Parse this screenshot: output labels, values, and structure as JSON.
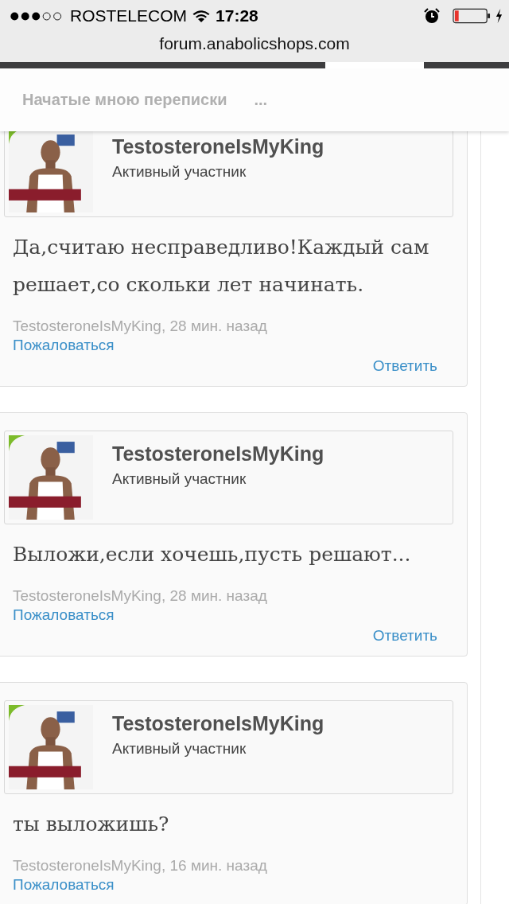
{
  "status_bar": {
    "carrier": "ROSTELECOM",
    "time": "17:28"
  },
  "address_bar": {
    "url": "forum.anabolicshops.com"
  },
  "nav": {
    "items": [
      {
        "label": "Начатые мною переписки"
      },
      {
        "label": "..."
      }
    ]
  },
  "posts": [
    {
      "author": "TestosteroneIsMyKing",
      "role": "Активный участник",
      "message": "Да,считаю несправедливо!Каждый сам решает,со скольки лет начинать.",
      "meta": "TestosteroneIsMyKing, 28 мин. назад",
      "report": "Пожаловаться",
      "reply": "Ответить"
    },
    {
      "author": "TestosteroneIsMyKing",
      "role": "Активный участник",
      "message": "Выложи,если хочешь,пусть решают...",
      "meta": "TestosteroneIsMyKing, 28 мин. назад",
      "report": "Пожаловаться",
      "reply": "Ответить"
    },
    {
      "author": "TestosteroneIsMyKing",
      "role": "Активный участник",
      "message": "ты выложишь?",
      "meta": "TestosteroneIsMyKing, 16 мин. назад",
      "report": "Пожаловаться"
    }
  ]
}
